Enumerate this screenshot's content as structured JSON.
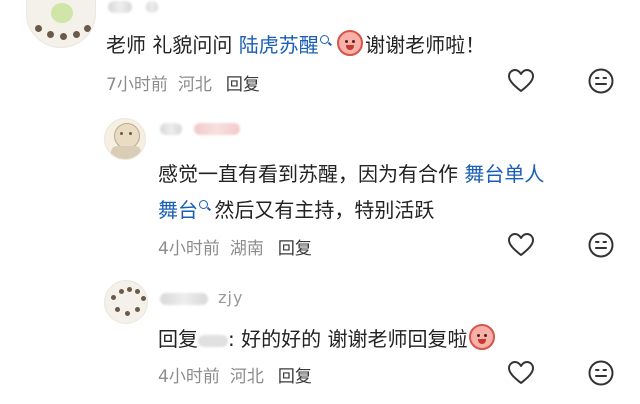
{
  "comments": [
    {
      "author_visible": "",
      "text_before": "老师 礼貌问问 ",
      "link_text": "陆虎苏醒",
      "text_after": "谢谢老师啦！",
      "time": "7小时前",
      "location": "河北",
      "reply_label": "回复"
    },
    {
      "author_visible": "",
      "line1_before": "感觉一直有看到苏醒，因为有合作 ",
      "line1_link": "舞台单人",
      "line2_link": "舞台",
      "line2_after": " 然后又有主持，特别活跃",
      "time": "4小时前",
      "location": "湖南",
      "reply_label": "回复"
    },
    {
      "author_visible": "zjy",
      "text_prefix": "回复",
      "text_main": ": 好的好的 谢谢老师回复啦",
      "time": "4小时前",
      "location": "河北",
      "reply_label": "回复"
    }
  ],
  "icons": {
    "like": "heart-icon",
    "emoji_react": "smiley-icon",
    "search_tag": "search-icon",
    "sticker": "blushing-face-emoji"
  },
  "colors": {
    "link": "#1a5fb4",
    "meta": "#8c8c8c",
    "text": "#222222"
  }
}
